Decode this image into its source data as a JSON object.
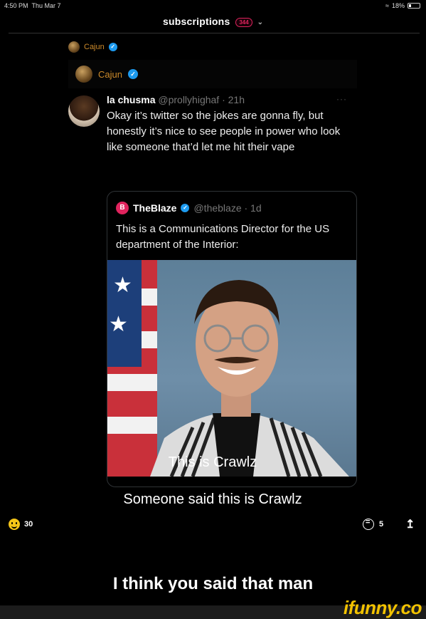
{
  "status_bar": {
    "time": "4:50 PM",
    "date": "Thu Mar 7",
    "battery": "18%"
  },
  "header": {
    "title": "subscriptions",
    "count": "344"
  },
  "author": {
    "name": "Cajun"
  },
  "embedded": {
    "header_name": "Cajun",
    "tweet": {
      "name": "la chusma",
      "handle": "@prollyhighaf · 21h",
      "text": "Okay it’s twitter so the jokes are gonna fly, but honestly it’s nice to see people in power who look like someone that’d let me hit their vape"
    },
    "quote": {
      "name": "TheBlaze",
      "handle": "@theblaze · 1d",
      "text": "This is a Communications Director for the US department of the Interior:"
    },
    "caption_1": "This is Crawlz",
    "caption_2": "Someone said this is Crawlz"
  },
  "actions": {
    "smiles": "30",
    "comments": "5"
  },
  "meme_caption": "I think you said that man",
  "watermark": "ifunny.co",
  "colors": {
    "accent_orange": "#cc8a2a",
    "verified_blue": "#1d9bf0",
    "badge_red": "#e0245e",
    "watermark_yellow": "#f2c200"
  }
}
